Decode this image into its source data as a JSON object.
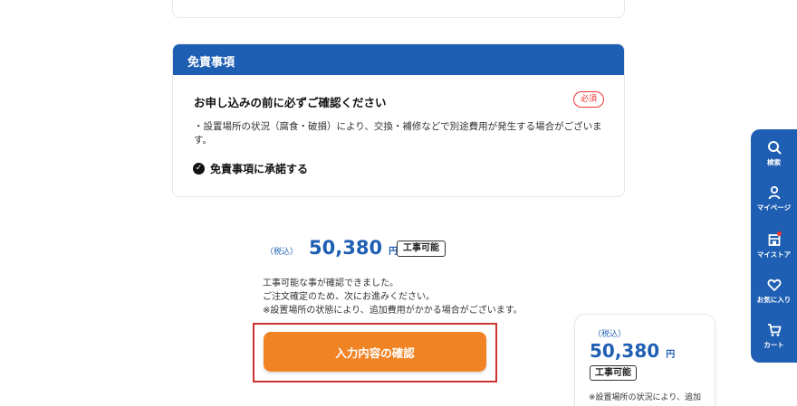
{
  "disclaimer": {
    "heading": "免責事項",
    "title": "お申し込みの前に必ずご確認ください",
    "required_badge": "必須",
    "body": "・設置場所の状況（腐食・破損）により、交換・補修などで別途費用が発生する場合がございます。",
    "agree_label": "免責事項に承諾する"
  },
  "price": {
    "tax_label": "（税込）",
    "value": "50,380",
    "yen": "円",
    "badge": "工事可能"
  },
  "notes": {
    "line1": "工事可能な事が確認できました。",
    "line2": "ご注文確定のため、次にお進みください。",
    "line3": "※設置場所の状態により、追加費用がかかる場合がございます。"
  },
  "confirm_button_label": "入力内容の確認",
  "side_card": {
    "tax_label": "（税込）",
    "value": "50,380",
    "yen": "円",
    "badge": "工事可能",
    "note": "※設置場所の状況により、追加"
  },
  "floating_nav": {
    "items": [
      {
        "label": "検索",
        "icon": "search-icon"
      },
      {
        "label": "マイページ",
        "icon": "user-icon"
      },
      {
        "label": "マイストア",
        "icon": "store-icon"
      },
      {
        "label": "お気に入り",
        "icon": "heart-icon"
      },
      {
        "label": "カート",
        "icon": "cart-icon"
      }
    ]
  },
  "colors": {
    "brand_blue": "#1f5fb3",
    "button_orange": "#f08324",
    "required_red": "#e33",
    "highlight_frame": "#c33"
  }
}
